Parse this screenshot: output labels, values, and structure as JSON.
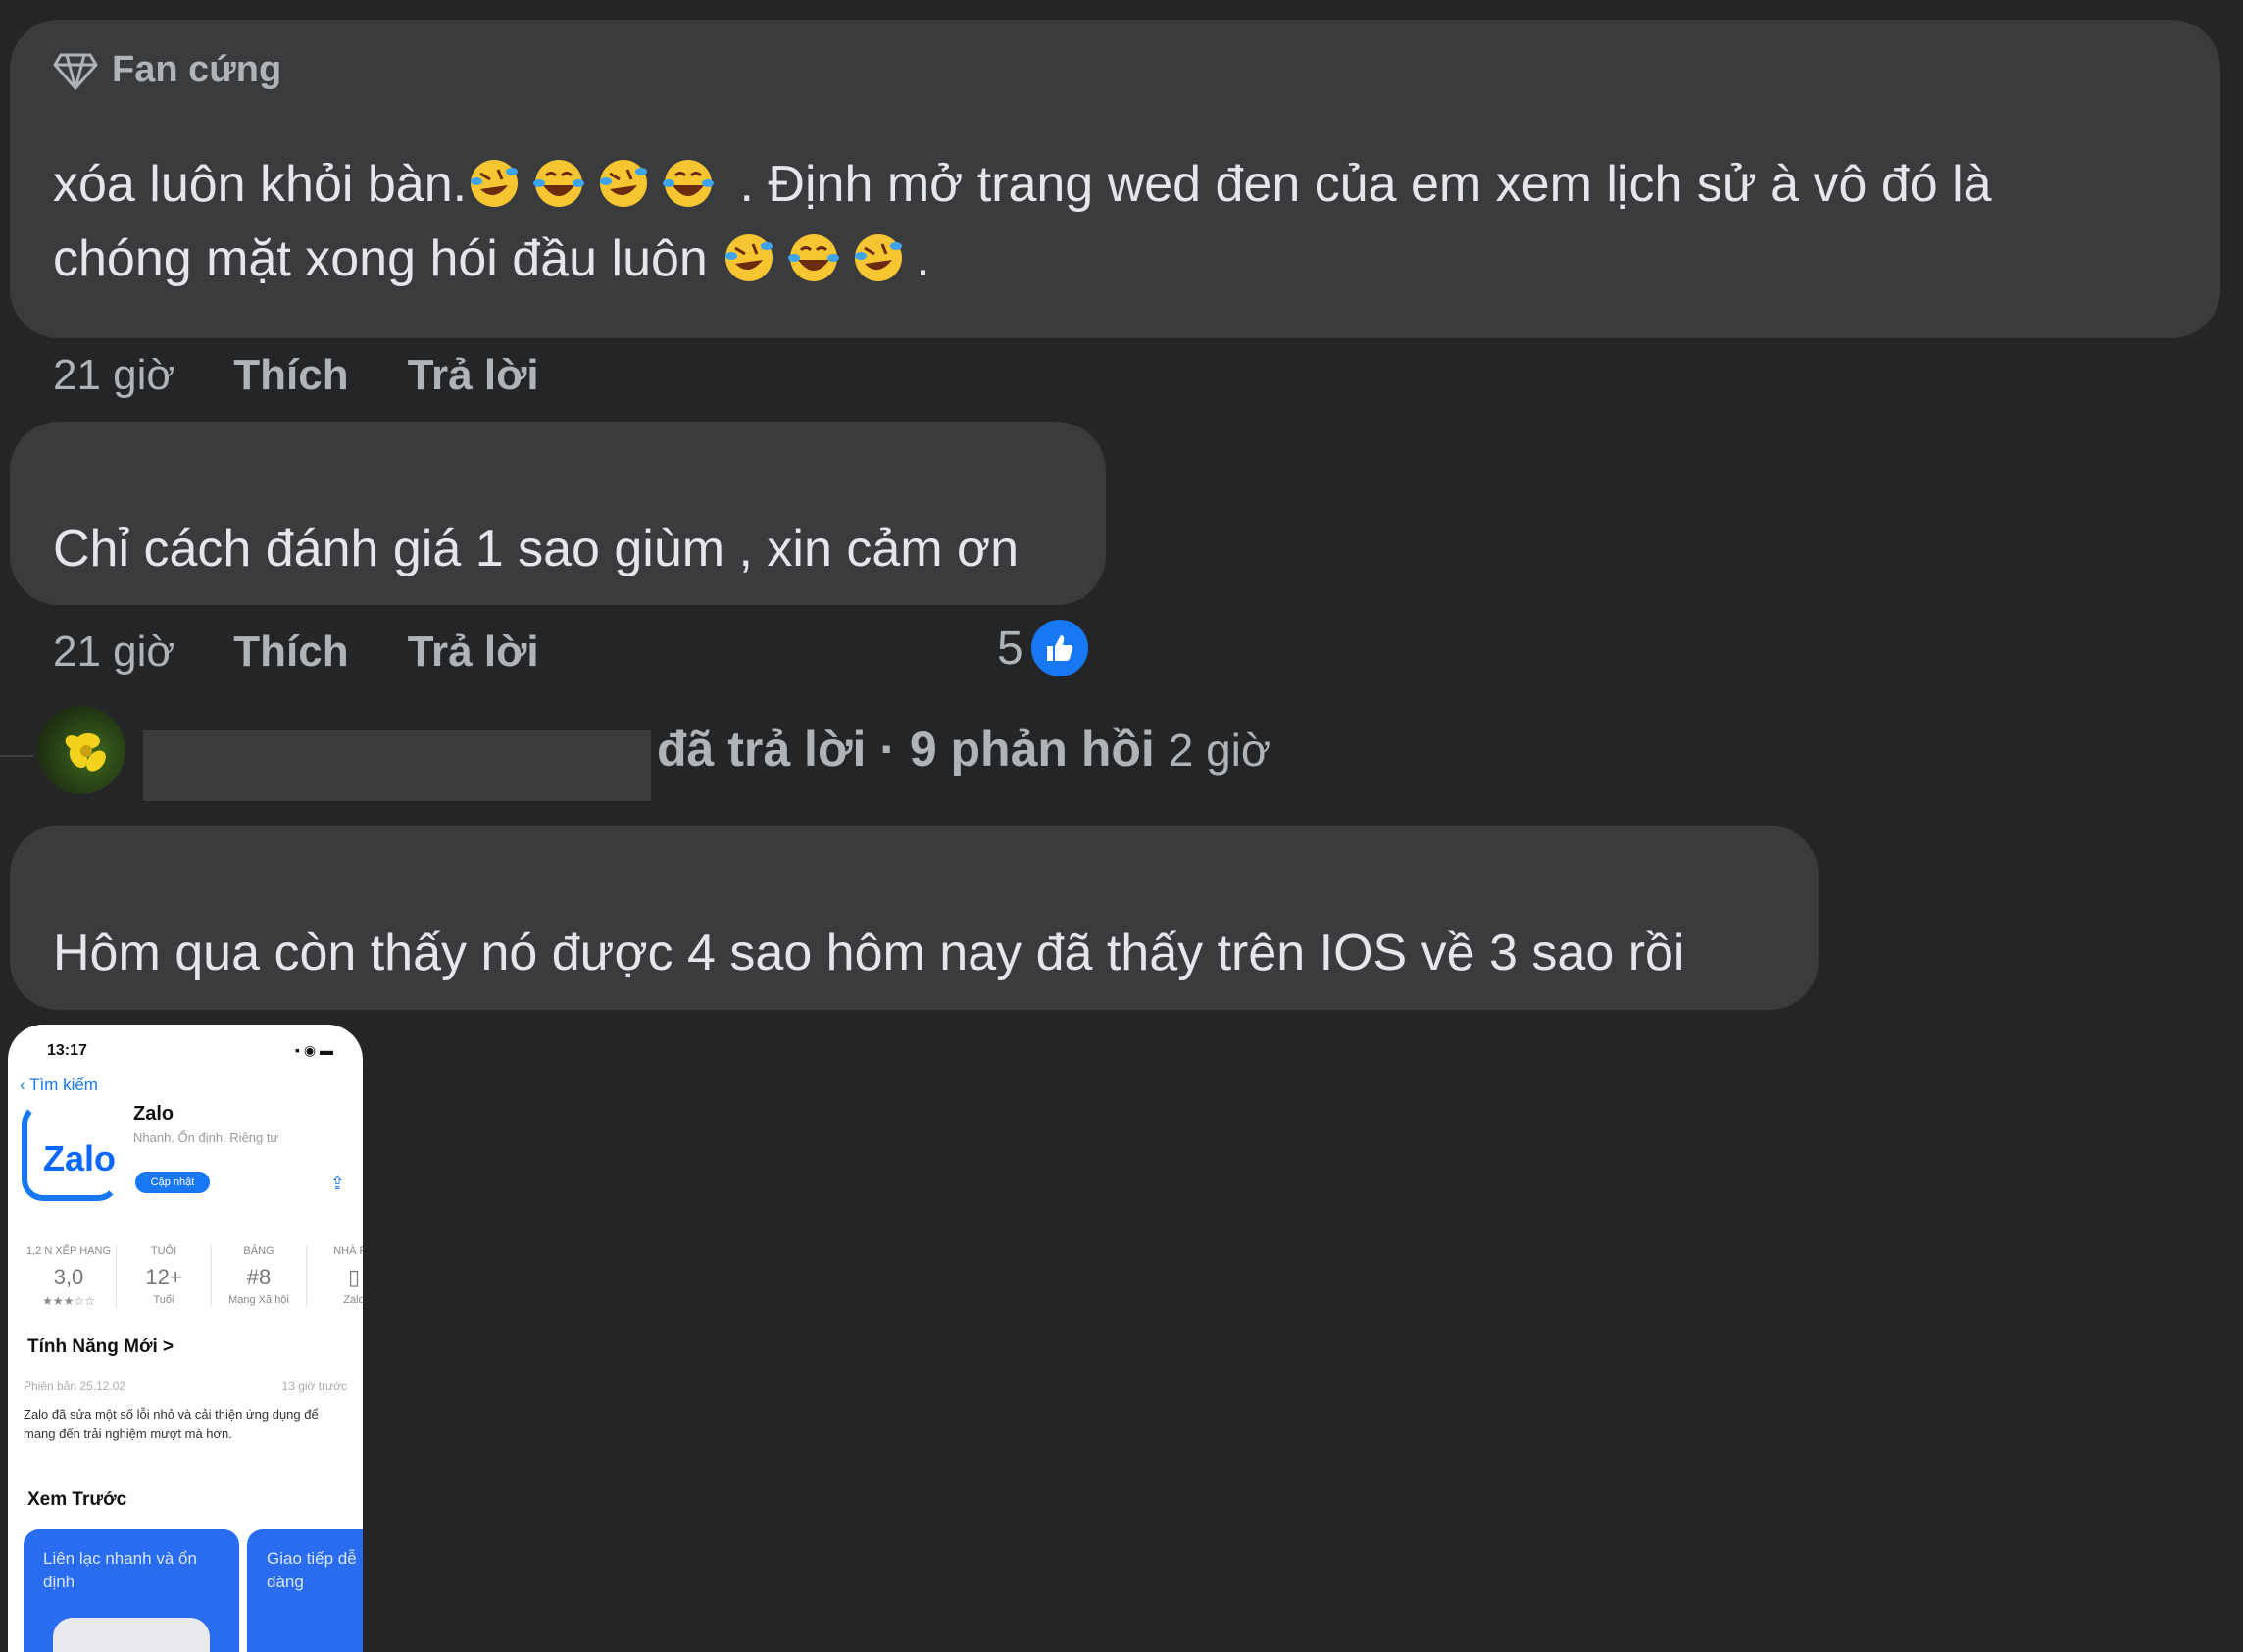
{
  "comments": [
    {
      "badge": "Fan cứng",
      "text_part1": "xóa luôn khỏi bàn.",
      "text_part2": " . Định mở trang wed đen của em xem lịch sử à vô đó là",
      "text_line2": "chóng mặt xong hói đầu luôn ",
      "text_end": ".",
      "time": "21 giờ",
      "like_label": "Thích",
      "reply_label": "Trả lời"
    },
    {
      "text": "Chỉ cách đánh giá 1 sao giùm , xin cảm ơn",
      "time": "21 giờ",
      "like_label": "Thích",
      "reply_label": "Trả lời",
      "reaction_count": "5"
    },
    {
      "text": "Hôm qua còn thấy nó được 4 sao hôm nay đã thấy trên IOS về 3 sao rồi"
    }
  ],
  "reply_summary": {
    "text": "đã trả lời · 9 phản hồi",
    "time": "2 giờ"
  },
  "attachment": {
    "status_time": "13:17",
    "back_label": "Tìm kiếm",
    "app_name": "Zalo",
    "app_icon_text": "Zalo",
    "app_subtitle": "Nhanh. Ổn định. Riêng tư",
    "get_label": "Cập nhật",
    "stats": [
      {
        "label": "1,2 N XẾP HẠNG",
        "value": "3,0",
        "sub": "★★★☆☆"
      },
      {
        "label": "TUỔI",
        "value": "12+",
        "sub": "Tuổi"
      },
      {
        "label": "BẢNG",
        "value": "#8",
        "sub": "Mạng Xã hội"
      },
      {
        "label": "NHÀ PH",
        "value": "▯",
        "sub": "Zalo"
      }
    ],
    "whats_new": "Tính Năng Mới >",
    "version": "Phiên bản 25.12.02",
    "version_time": "13 giờ trước",
    "notes": "Zalo đã sửa một số lỗi nhỏ và cải thiện ứng dụng để mang đến trải nghiệm mượt mà hơn.",
    "preview_title": "Xem Trước",
    "card1": "Liên lạc nhanh và ổn định",
    "card2": "Giao tiếp dễ dàng"
  },
  "colors": {
    "background": "#242526",
    "bubble": "#3a3b3c",
    "like_blue": "#1877f2"
  },
  "icons": {
    "badge": "diamond-icon",
    "emoji_a": "rolling-on-floor-laughing-emoji",
    "emoji_b": "tears-of-joy-emoji",
    "reaction": "thumbs-up-icon"
  }
}
